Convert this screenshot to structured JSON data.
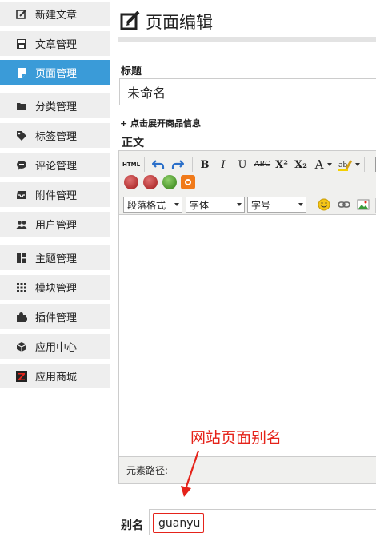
{
  "sidebar": {
    "items": [
      {
        "label": "新建文章",
        "icon": "edit-icon"
      },
      {
        "label": "文章管理",
        "icon": "save-icon"
      },
      {
        "label": "页面管理",
        "icon": "page-icon",
        "active": true
      },
      {
        "label": "分类管理",
        "icon": "folder-icon"
      },
      {
        "label": "标签管理",
        "icon": "tag-icon"
      },
      {
        "label": "评论管理",
        "icon": "comment-icon"
      },
      {
        "label": "附件管理",
        "icon": "inbox-icon"
      },
      {
        "label": "用户管理",
        "icon": "users-icon"
      },
      {
        "label": "主题管理",
        "icon": "layout-icon"
      },
      {
        "label": "模块管理",
        "icon": "grid-icon"
      },
      {
        "label": "插件管理",
        "icon": "puzzle-icon"
      },
      {
        "label": "应用中心",
        "icon": "box-icon"
      },
      {
        "label": "应用商城",
        "icon": "z-store-icon"
      }
    ],
    "active_color": "#3a9bd8"
  },
  "main": {
    "title": "页面编辑",
    "title_label": "标题",
    "title_value": "未命名",
    "expand_link": "+ 点击展开商品信息",
    "body_label": "正文"
  },
  "editor": {
    "toolbar": {
      "html_label": "HTML",
      "bold": "B",
      "italic": "I",
      "underline": "U",
      "strike": "ABC",
      "superscript": "X²",
      "subscript": "X₂",
      "font_color": "A",
      "paragraph_select": "段落格式",
      "font_select": "字体",
      "size_select": "字号"
    },
    "status_label": "元素路径:"
  },
  "annotation": {
    "text": "网站页面别名",
    "color": "#e5231a"
  },
  "alias": {
    "label": "别名",
    "value": "guanyu"
  }
}
